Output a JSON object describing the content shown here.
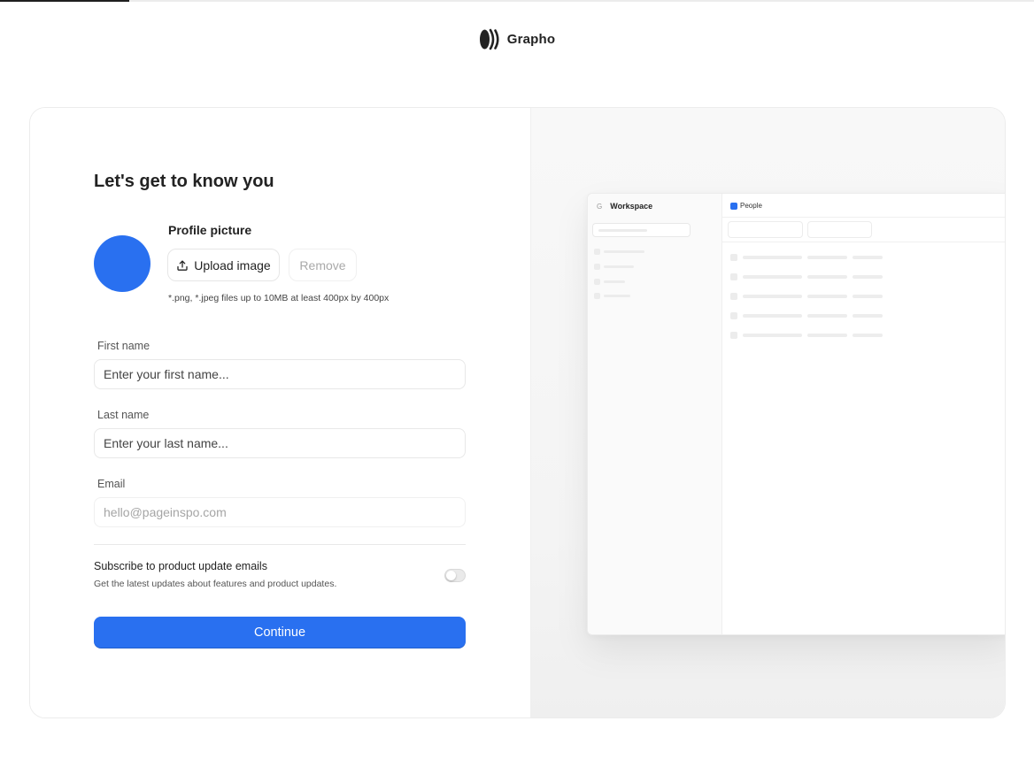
{
  "progress": {
    "fraction": 0.125
  },
  "brand": {
    "name": "Grapho",
    "logo_icon": "grapho-logo-icon"
  },
  "form": {
    "title": "Let's get to know you",
    "profile_picture": {
      "label": "Profile picture",
      "upload_label": "Upload image",
      "upload_icon": "upload-icon",
      "remove_label": "Remove",
      "hint": "*.png, *.jpeg files up to 10MB at least 400px by 400px",
      "avatar_color": "#2970F0"
    },
    "first_name": {
      "label": "First name",
      "placeholder": "Enter your first name..."
    },
    "last_name": {
      "label": "Last name",
      "placeholder": "Enter your last name..."
    },
    "email": {
      "label": "Email",
      "placeholder": "hello@pageinspo.com"
    },
    "subscribe": {
      "title": "Subscribe to product update emails",
      "description": "Get the latest updates about features and product updates.",
      "enabled": false
    },
    "continue_label": "Continue"
  },
  "preview": {
    "sidebar_initial": "G",
    "workspace_label": "Workspace",
    "tab_label": "People",
    "tab_color": "#2970F0"
  },
  "colors": {
    "accent": "#2970F0",
    "text": "#222222",
    "muted": "#A9A9A9"
  }
}
